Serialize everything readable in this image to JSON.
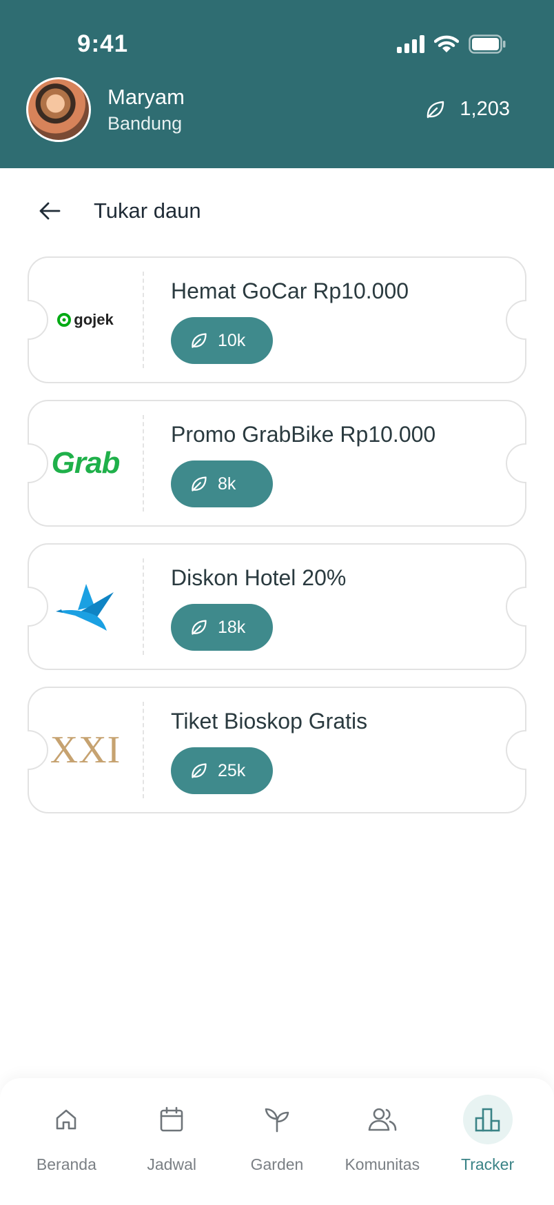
{
  "status_bar": {
    "time": "9:41",
    "signal_icon": "signal-icon",
    "wifi_icon": "wifi-icon",
    "battery_icon": "battery-icon"
  },
  "profile": {
    "name": "Maryam",
    "city": "Bandung",
    "points": "1,203",
    "points_icon": "leaf-icon"
  },
  "page": {
    "title": "Tukar daun",
    "back_icon": "back-arrow-icon"
  },
  "vouchers": [
    {
      "brand": "gojek",
      "logo_text": "gojek",
      "title": "Hemat GoCar Rp10.000",
      "cost": "10k"
    },
    {
      "brand": "grab",
      "logo_text": "Grab",
      "title": "Promo GrabBike Rp10.000",
      "cost": "8k"
    },
    {
      "brand": "traveloka",
      "logo_text": "",
      "title": "Diskon Hotel 20%",
      "cost": "18k"
    },
    {
      "brand": "xxi",
      "logo_text": "XXI",
      "title": "Tiket Bioskop Gratis",
      "cost": "25k"
    }
  ],
  "nav": {
    "items": [
      {
        "label": "Beranda",
        "icon": "home-icon"
      },
      {
        "label": "Jadwal",
        "icon": "calendar-icon"
      },
      {
        "label": "Garden",
        "icon": "sprout-icon"
      },
      {
        "label": "Komunitas",
        "icon": "users-icon"
      },
      {
        "label": "Tracker",
        "icon": "bar-chart-icon",
        "active": true
      }
    ]
  },
  "colors": {
    "header": "#2f6d72",
    "accent": "#3f8a8c",
    "active_nav": "#3a8386",
    "grab_green": "#1fb04a",
    "xxi_gold": "#c6a270",
    "traveloka_blue": "#1ba0e2"
  }
}
